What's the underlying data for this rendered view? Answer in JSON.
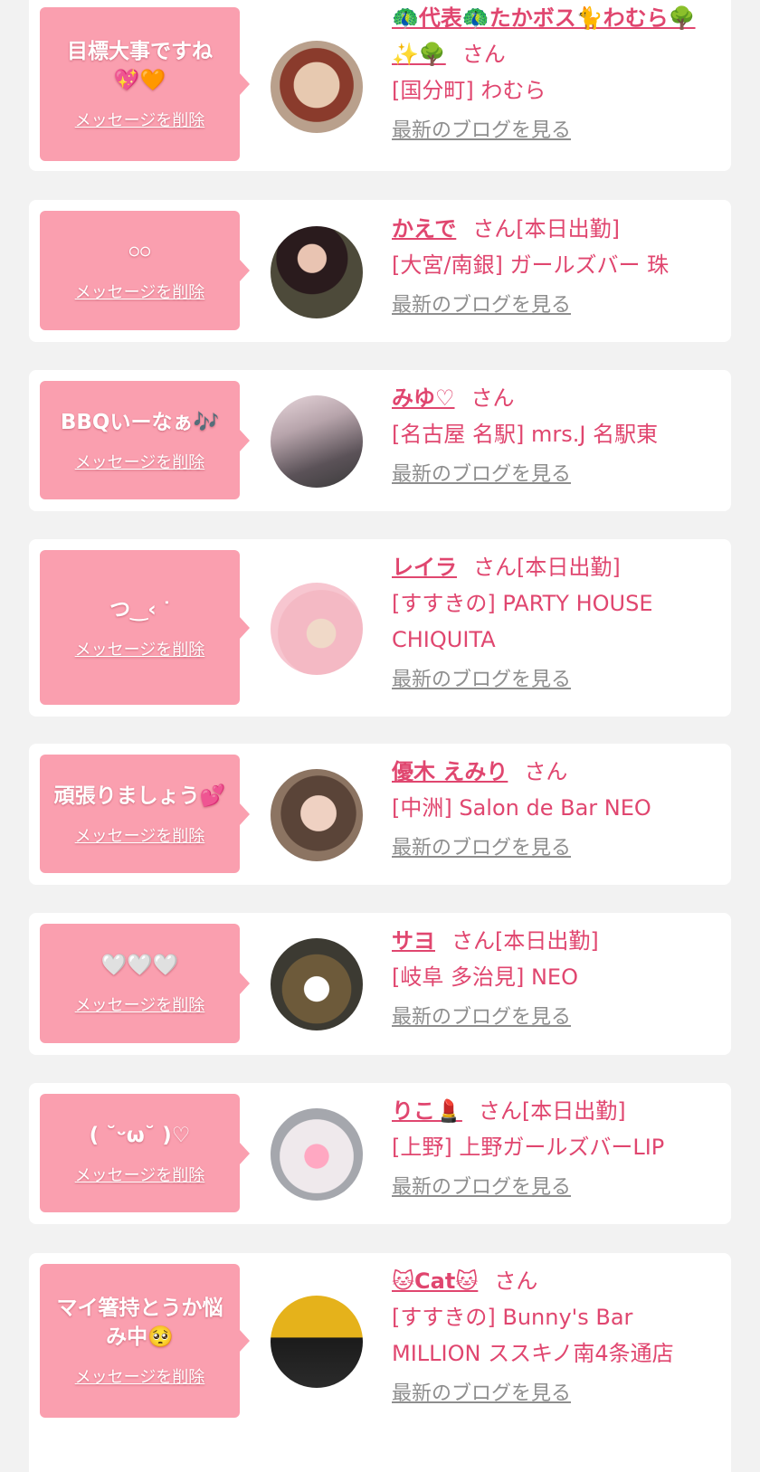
{
  "delete_label": "メッセージを削除",
  "blog_label": "最新のブログを見る",
  "colors": {
    "bubble": "#fa9faf",
    "accent": "#e0466f",
    "link_gray": "#8e8e8e",
    "background": "#f2f2f2"
  },
  "favorites": [
    {
      "message": "目標大事ですね 💖🧡",
      "name": "🦚代表🦚たかボス🐈わむら🌳✨🌳",
      "suffix": "さん",
      "shop": "[国分町] わむら",
      "avatar_icon": "face-photo"
    },
    {
      "message": "𓏸𓏸",
      "name": "かえで",
      "suffix": "さん[本日出勤]",
      "shop": "[大宮/南銀] ガールズバー 珠",
      "avatar_icon": "portrait-photo"
    },
    {
      "message": "BBQいーなぁ🎶",
      "name": "みゆ♡",
      "suffix": "さん",
      "shop": "[名古屋 名駅] mrs.J 名駅東",
      "avatar_icon": "portrait-photo"
    },
    {
      "message": "つ‿‹ ᐝ",
      "name": "レイラ",
      "suffix": "さん[本日出勤]",
      "shop": "[すすきの] PARTY HOUSE CHIQUITA",
      "avatar_icon": "bunny-portrait-photo"
    },
    {
      "message": "頑張りましょう💕",
      "name": "優木 えみり",
      "suffix": "さん",
      "shop": "[中洲] Salon de Bar NEO",
      "avatar_icon": "portrait-photo"
    },
    {
      "message": "🤍🤍🤍",
      "name": "サヨ",
      "suffix": "さん[本日出勤]",
      "shop": "[岐阜 多治見] NEO",
      "avatar_icon": "heart-covered-portrait-photo"
    },
    {
      "message": "( ˘ᵕω˘ )♡",
      "name": "りこ💄",
      "suffix": "さん[本日出勤]",
      "shop": "[上野] 上野ガールズバーLIP",
      "avatar_icon": "heart-covered-portrait-photo"
    },
    {
      "message": "マイ箸持とうか悩み中🥺",
      "name": "🐱Cat🐱",
      "suffix": "さん",
      "shop": "[すすきの] Bunny's Bar MILLION ススキノ南4条通店",
      "avatar_icon": "million-poster-photo"
    }
  ]
}
